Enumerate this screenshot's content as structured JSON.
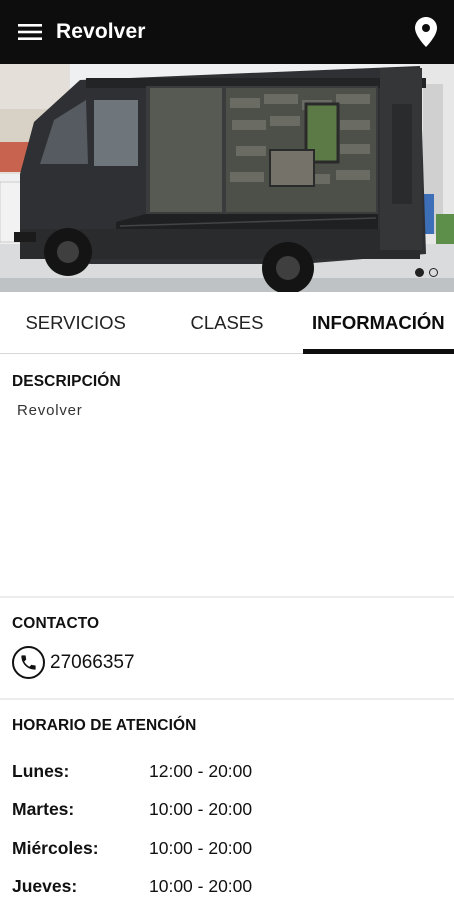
{
  "app_bar": {
    "title": "Revolver",
    "icons": {
      "menu": "menu-icon",
      "location": "location-pin-icon"
    }
  },
  "hero": {
    "image": "food-truck-photo",
    "carousel": {
      "count": 2,
      "active_index": 0
    }
  },
  "tabs": [
    {
      "label": "SERVICIOS",
      "active": false
    },
    {
      "label": "CLASES",
      "active": false
    },
    {
      "label": "INFORMACIÓN",
      "active": true
    }
  ],
  "descripcion": {
    "title": "DESCRIPCIÓN",
    "text": "Revolver"
  },
  "contacto": {
    "title": "CONTACTO",
    "phone": "27066357",
    "icon": "phone-icon"
  },
  "horario": {
    "title": "HORARIO DE ATENCIÓN",
    "rows": [
      {
        "day": "Lunes:",
        "time": "12:00 - 20:00"
      },
      {
        "day": "Martes:",
        "time": "10:00 - 20:00"
      },
      {
        "day": "Miércoles:",
        "time": "10:00 - 20:00"
      },
      {
        "day": "Jueves:",
        "time": "10:00 - 20:00"
      }
    ]
  },
  "colors": {
    "app_bar": "#0d0d0d",
    "accent": "#0d0d0d",
    "background": "#ffffff"
  }
}
